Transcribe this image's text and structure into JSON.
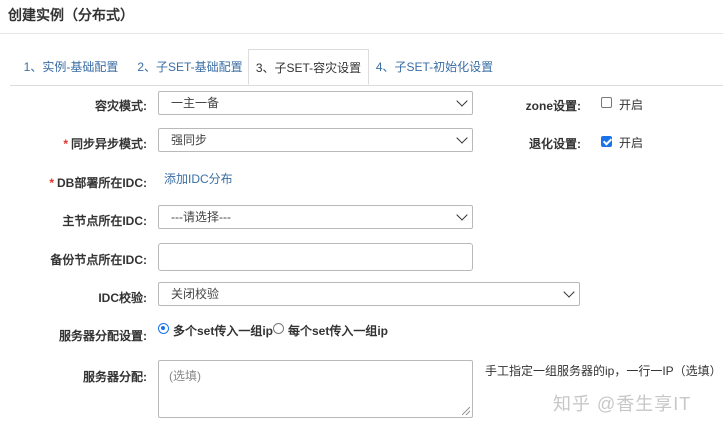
{
  "page_title": "创建实例（分布式）",
  "tabs": [
    {
      "label": "1、实例-基础配置",
      "active": false
    },
    {
      "label": "2、子SET-基础配置",
      "active": false
    },
    {
      "label": "3、子SET-容灾设置",
      "active": true
    },
    {
      "label": "4、子SET-初始化设置",
      "active": false
    }
  ],
  "form": {
    "dr_mode": {
      "label": "容灾模式:",
      "value": "一主一备"
    },
    "sync_mode": {
      "required_mark": "*",
      "label": "同步异步模式:",
      "value": "强同步"
    },
    "db_idc": {
      "required_mark": "*",
      "label": "DB部署所在IDC:",
      "link": "添加IDC分布"
    },
    "master_idc": {
      "label": "主节点所在IDC:",
      "value": "---请选择---"
    },
    "backup_idc": {
      "label": "备份节点所在IDC:",
      "value": ""
    },
    "idc_check": {
      "label": "IDC校验:",
      "value": "关闭校验"
    },
    "server_alloc_setting": {
      "label": "服务器分配设置:",
      "options": [
        {
          "label": "多个set传入一组ip",
          "checked": true
        },
        {
          "label": "每个set传入一组ip",
          "checked": false
        }
      ]
    },
    "server_alloc": {
      "label": "服务器分配:",
      "placeholder": "(选填)",
      "hint": "手工指定一组服务器的ip，一行一IP（选填）"
    },
    "zone": {
      "label": "zone设置:",
      "option_label": "开启",
      "checked": false
    },
    "degrade": {
      "label": "退化设置:",
      "option_label": "开启",
      "checked": true
    }
  },
  "watermark": "知乎 @香生享IT",
  "colors": {
    "link": "#3a6ea5",
    "required": "#e0332d",
    "accent": "#1a73e8"
  }
}
